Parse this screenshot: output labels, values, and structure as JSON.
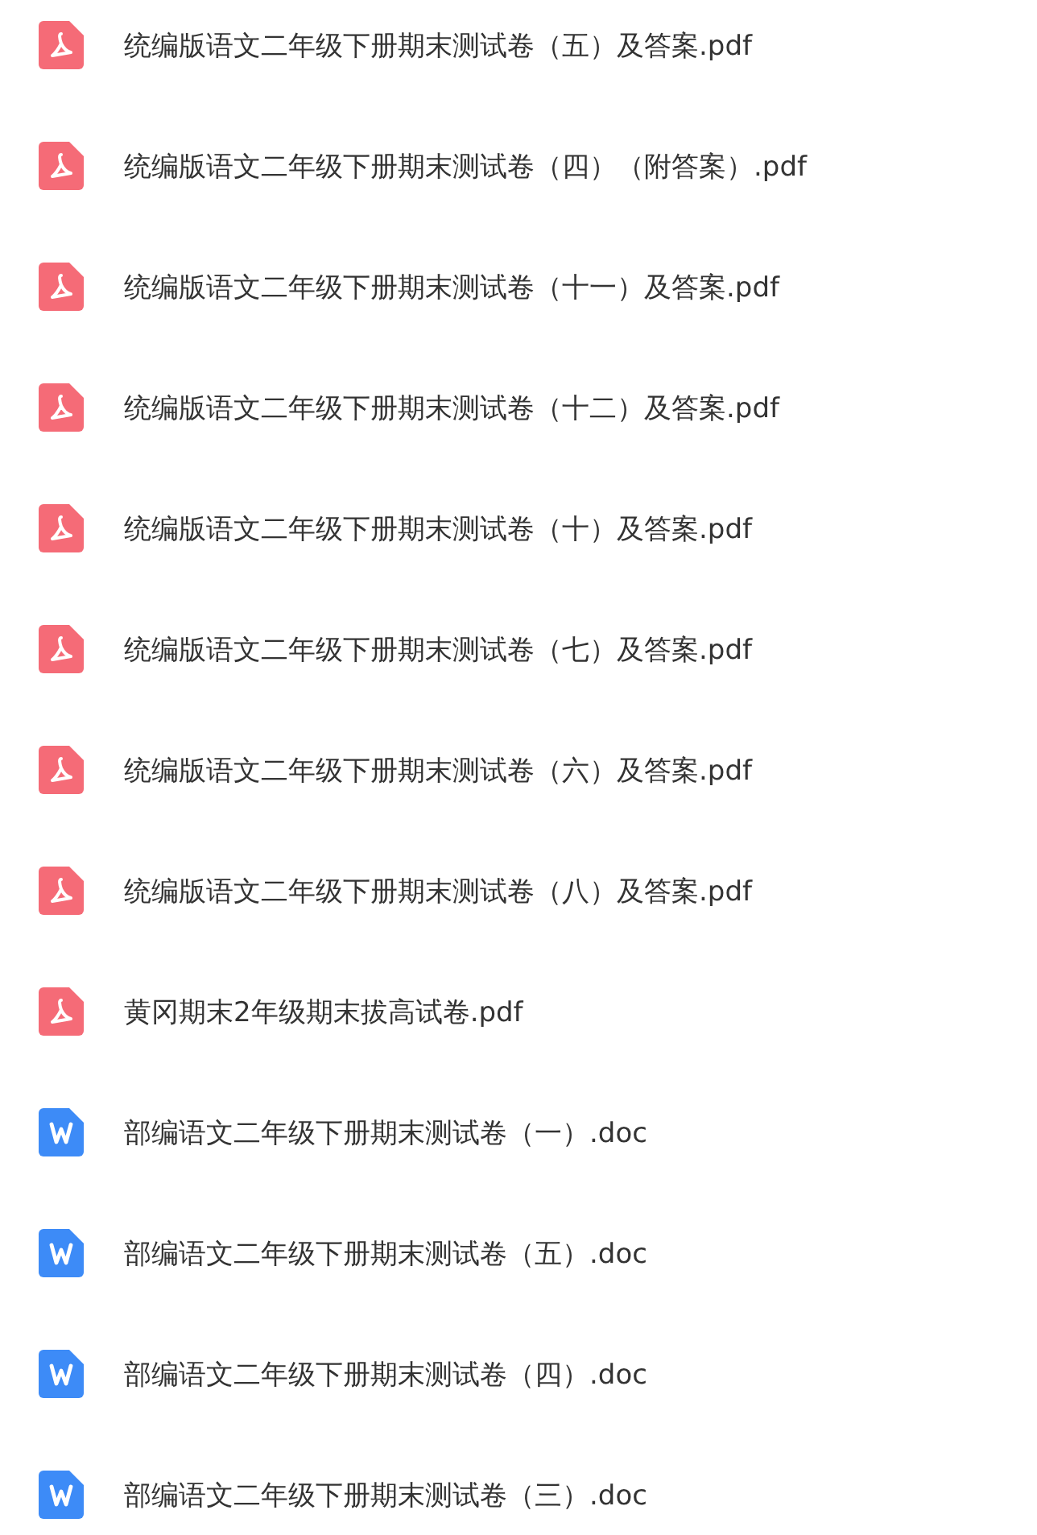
{
  "files": [
    {
      "kind": "pdf",
      "name": "统编版语文二年级下册期末测试卷（五）及答案.pdf"
    },
    {
      "kind": "pdf",
      "name": "统编版语文二年级下册期末测试卷（四）（附答案）.pdf"
    },
    {
      "kind": "pdf",
      "name": "统编版语文二年级下册期末测试卷（十一）及答案.pdf"
    },
    {
      "kind": "pdf",
      "name": "统编版语文二年级下册期末测试卷（十二）及答案.pdf"
    },
    {
      "kind": "pdf",
      "name": "统编版语文二年级下册期末测试卷（十）及答案.pdf"
    },
    {
      "kind": "pdf",
      "name": "统编版语文二年级下册期末测试卷（七）及答案.pdf"
    },
    {
      "kind": "pdf",
      "name": "统编版语文二年级下册期末测试卷（六）及答案.pdf"
    },
    {
      "kind": "pdf",
      "name": "统编版语文二年级下册期末测试卷（八）及答案.pdf"
    },
    {
      "kind": "pdf",
      "name": "黄冈期末2年级期末拔高试卷.pdf"
    },
    {
      "kind": "doc",
      "name": "部编语文二年级下册期末测试卷（一）.doc"
    },
    {
      "kind": "doc",
      "name": "部编语文二年级下册期末测试卷（五）.doc"
    },
    {
      "kind": "doc",
      "name": "部编语文二年级下册期末测试卷（四）.doc"
    },
    {
      "kind": "doc",
      "name": "部编语文二年级下册期末测试卷（三）.doc"
    }
  ]
}
